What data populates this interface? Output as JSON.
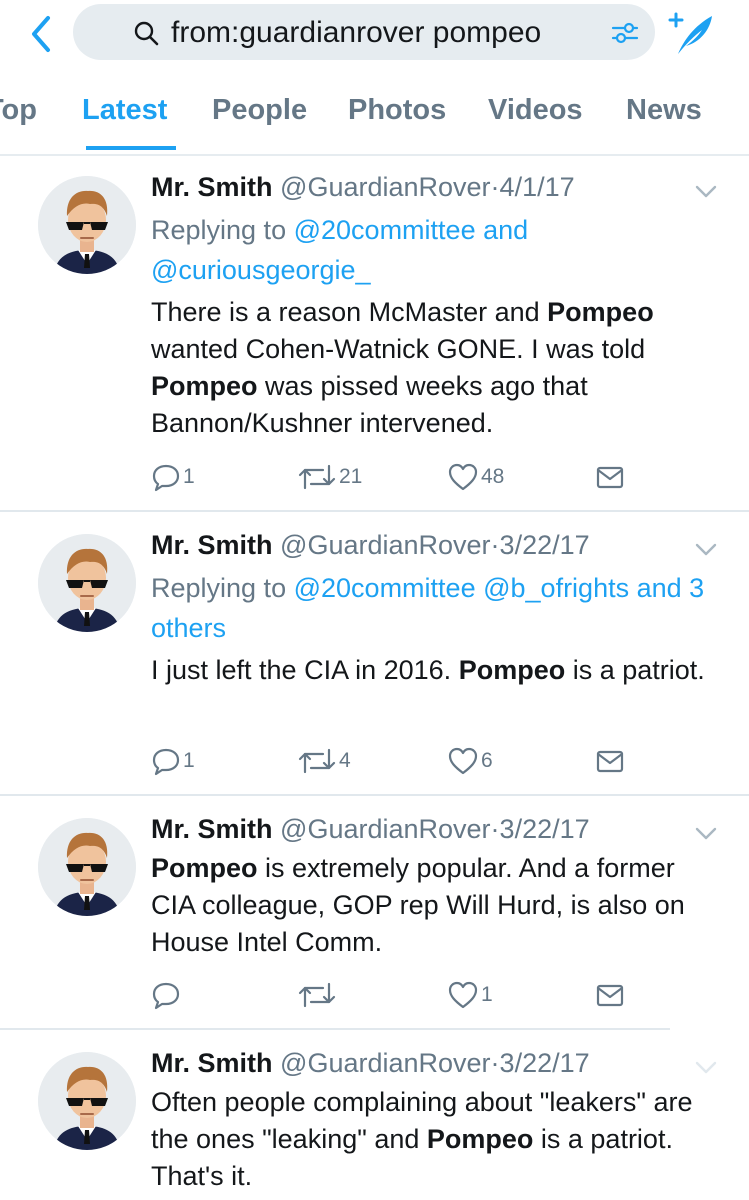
{
  "search": {
    "query": "from:guardianrover pompeo"
  },
  "tabs": [
    {
      "label": "Top"
    },
    {
      "label": "Latest"
    },
    {
      "label": "People"
    },
    {
      "label": "Photos"
    },
    {
      "label": "Videos"
    },
    {
      "label": "News"
    }
  ],
  "colors": {
    "accent": "#1da1f2",
    "text": "#14171a",
    "muted": "#657786",
    "divider": "#e1e8ed"
  },
  "tweets": [
    {
      "name": "Mr. Smith",
      "handle": "@GuardianRover",
      "dot": "·",
      "date": "4/1/17",
      "replying_prefix": "Replying to",
      "mentions": [
        "@20committee",
        "and",
        "@curiousgeorgie_"
      ],
      "text": [
        "There is a reason McMaster and ",
        "Pompeo",
        " wanted Cohen-Watnick GONE. I was told ",
        "Pompeo",
        " was pissed weeks ago that Bannon/Kushner intervened."
      ],
      "reply_count": "1",
      "retweet_count": "21",
      "like_count": "48"
    },
    {
      "name": "Mr. Smith",
      "handle": "@GuardianRover",
      "dot": "·",
      "date": "3/22/17",
      "replying_prefix": "Replying to",
      "mentions": [
        "@20committee",
        "@b_ofrights",
        "and 3 others"
      ],
      "text": [
        "I just left the CIA in 2016. ",
        "Pompeo",
        " is a patriot."
      ],
      "reply_count": "1",
      "retweet_count": "4",
      "like_count": "6"
    },
    {
      "name": "Mr. Smith",
      "handle": "@GuardianRover",
      "dot": "·",
      "date": "3/22/17",
      "text": [
        "Pompeo",
        " is extremely popular. And a former CIA colleague, GOP rep Will Hurd, is also on House Intel Comm."
      ],
      "reply_count": "",
      "retweet_count": "",
      "like_count": "1"
    },
    {
      "name": "Mr. Smith",
      "handle": "@GuardianRover",
      "dot": "·",
      "date": "3/22/17",
      "text": [
        "Often people complaining about \"leakers\" are the ones \"leaking\" and ",
        "Pompeo",
        " is a patriot. That's it."
      ]
    }
  ]
}
